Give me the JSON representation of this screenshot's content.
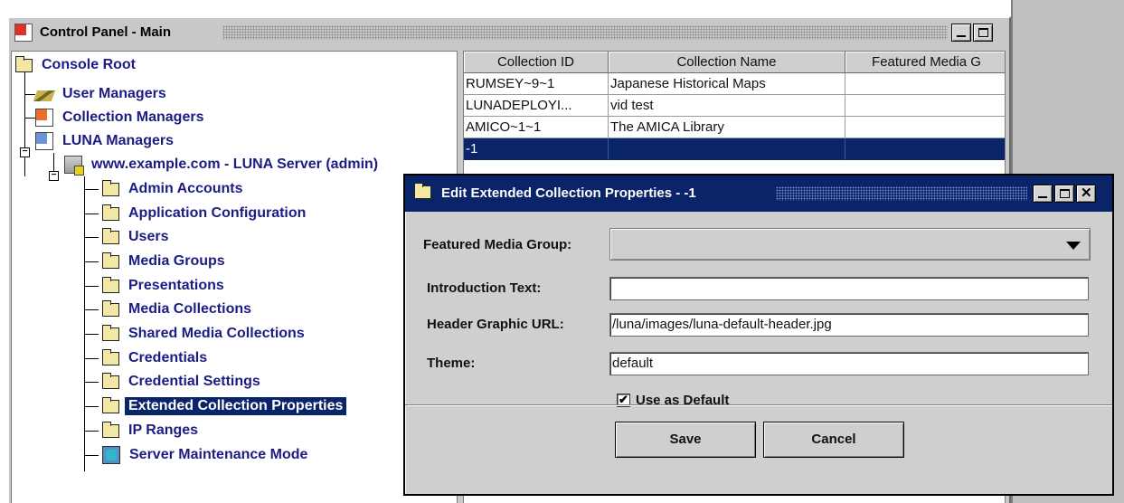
{
  "window": {
    "title": "Control Panel - Main",
    "controls": [
      "minimize",
      "maximize"
    ]
  },
  "tree": {
    "root": "Console Root",
    "items": [
      {
        "label": "User Managers",
        "icon": "user-managers-icon"
      },
      {
        "label": "Collection Managers",
        "icon": "collection-managers-icon"
      },
      {
        "label": "LUNA Managers",
        "icon": "luna-managers-icon"
      },
      {
        "label": "www.example.com - LUNA Server (admin)",
        "icon": "server-icon"
      },
      {
        "label": "Admin Accounts",
        "icon": "folder-icon"
      },
      {
        "label": "Application Configuration",
        "icon": "folder-icon"
      },
      {
        "label": "Users",
        "icon": "folder-icon"
      },
      {
        "label": "Media Groups",
        "icon": "folder-icon"
      },
      {
        "label": "Presentations",
        "icon": "folder-icon"
      },
      {
        "label": "Media Collections",
        "icon": "folder-icon"
      },
      {
        "label": "Shared Media Collections",
        "icon": "folder-icon"
      },
      {
        "label": "Credentials",
        "icon": "folder-icon"
      },
      {
        "label": "Credential Settings",
        "icon": "folder-icon"
      },
      {
        "label": "Extended Collection Properties",
        "icon": "folder-icon",
        "selected": true
      },
      {
        "label": "IP Ranges",
        "icon": "folder-icon"
      },
      {
        "label": "Server Maintenance Mode",
        "icon": "maintenance-icon"
      }
    ]
  },
  "table": {
    "columns": [
      "Collection ID",
      "Collection Name",
      "Featured Media G"
    ],
    "rows": [
      [
        "RUMSEY~9~1",
        "Japanese Historical Maps",
        ""
      ],
      [
        "LUNADEPLOYI...",
        "vid test",
        ""
      ],
      [
        "AMICO~1~1",
        "The AMICA Library",
        ""
      ],
      [
        "-1",
        "",
        ""
      ]
    ],
    "selected_row": 3
  },
  "dialog": {
    "title": "Edit Extended Collection Properties - -1",
    "fields": {
      "featured_media_group": {
        "label": "Featured Media Group:",
        "value": ""
      },
      "introduction_text": {
        "label": "Introduction Text:",
        "value": ""
      },
      "header_graphic_url": {
        "label": "Header Graphic URL:",
        "value": "/luna/images/luna-default-header.jpg"
      },
      "theme": {
        "label": "Theme:",
        "value": "default"
      }
    },
    "use_as_default": {
      "label": "Use as Default",
      "checked": true,
      "mark": "✔"
    },
    "buttons": {
      "save": "Save",
      "cancel": "Cancel"
    }
  },
  "colors": {
    "selection": "#0a246a",
    "tree_text": "#1c1c84",
    "chrome": "#c8c8c8"
  }
}
